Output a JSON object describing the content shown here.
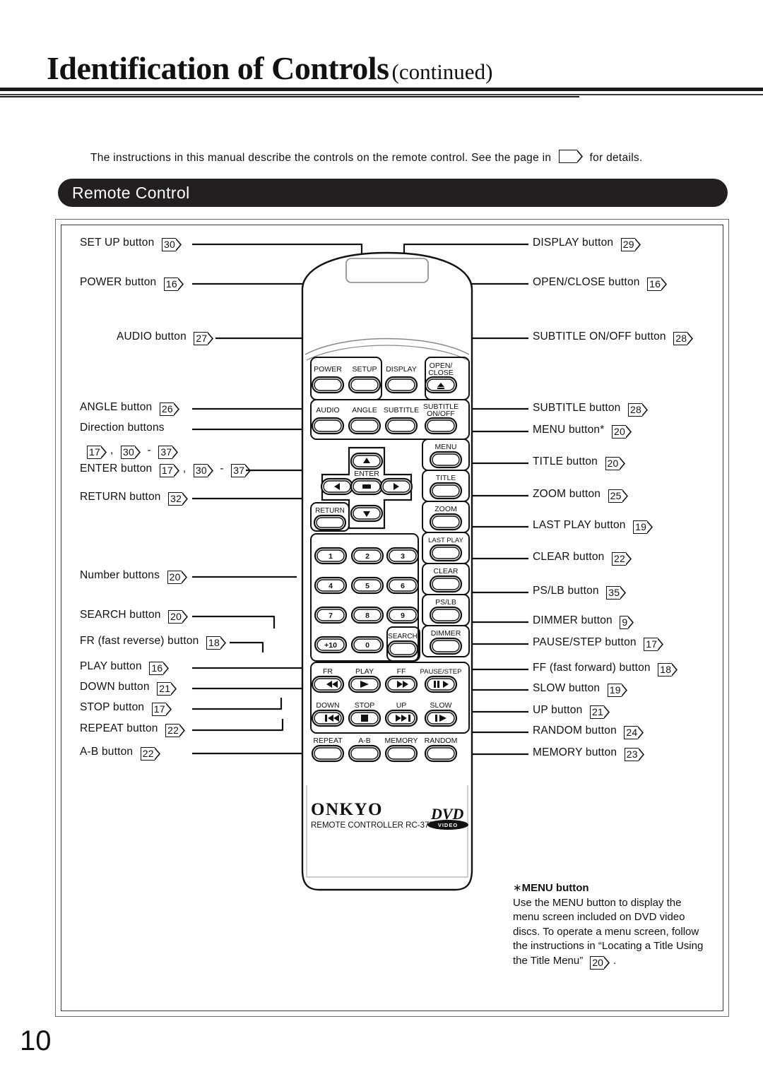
{
  "header": {
    "title_main": "Identification of Controls",
    "title_cont": "(continued)"
  },
  "intro": {
    "before": "The instructions in this manual describe the controls on the remote control. See the page in",
    "after": "for details."
  },
  "section": {
    "banner_label": "Remote Control"
  },
  "page_number": "10",
  "labels_left": [
    {
      "name": "setup",
      "text": "SET UP button",
      "ref": "30"
    },
    {
      "name": "power",
      "text": "POWER button",
      "ref": "16"
    },
    {
      "name": "audio",
      "text": "AUDIO button",
      "ref": "27"
    },
    {
      "name": "angle",
      "text": "ANGLE button",
      "ref": "26"
    },
    {
      "name": "direction",
      "text": "Direction buttons",
      "ref": ""
    },
    {
      "name": "enter",
      "text": "ENTER button",
      "ref": ""
    },
    {
      "name": "return",
      "text": "RETURN button",
      "ref": "32"
    },
    {
      "name": "number",
      "text": "Number buttons",
      "ref": "20"
    },
    {
      "name": "search",
      "text": "SEARCH button",
      "ref": "20"
    },
    {
      "name": "fr",
      "text": "FR (fast reverse) button",
      "ref": "18"
    },
    {
      "name": "play",
      "text": "PLAY button",
      "ref": "16"
    },
    {
      "name": "down",
      "text": "DOWN button",
      "ref": "21"
    },
    {
      "name": "stop",
      "text": "STOP button",
      "ref": "17"
    },
    {
      "name": "repeat",
      "text": "REPEAT button",
      "ref": "22"
    },
    {
      "name": "ab",
      "text": "A-B  button",
      "ref": "22"
    }
  ],
  "direction_refs": {
    "a": "17",
    "b": "30",
    "dash": "-",
    "c": "37",
    "comma": ","
  },
  "labels_right": [
    {
      "name": "display",
      "text": "DISPLAY button",
      "ref": "29"
    },
    {
      "name": "open-close",
      "text": "OPEN/CLOSE button",
      "ref": "16"
    },
    {
      "name": "subtitle-onoff",
      "text": "SUBTITLE ON/OFF button",
      "ref": "28"
    },
    {
      "name": "subtitle",
      "text": "SUBTITLE button",
      "ref": "28"
    },
    {
      "name": "menu",
      "text": "MENU button*",
      "ref": "20"
    },
    {
      "name": "title",
      "text": "TITLE button",
      "ref": "20"
    },
    {
      "name": "zoom",
      "text": "ZOOM button",
      "ref": "25"
    },
    {
      "name": "last-play",
      "text": "LAST PLAY button",
      "ref": "19"
    },
    {
      "name": "clear",
      "text": "CLEAR button",
      "ref": "22"
    },
    {
      "name": "pslb",
      "text": "PS/LB button",
      "ref": "35"
    },
    {
      "name": "dimmer",
      "text": "DIMMER button",
      "ref": "9"
    },
    {
      "name": "pause-step",
      "text": "PAUSE/STEP button",
      "ref": "17"
    },
    {
      "name": "ff",
      "text": "FF (fast forward) button",
      "ref": "18"
    },
    {
      "name": "slow",
      "text": "SLOW button",
      "ref": "19"
    },
    {
      "name": "up",
      "text": "UP button",
      "ref": "21"
    },
    {
      "name": "random",
      "text": "RANDOM button",
      "ref": "24"
    },
    {
      "name": "memory",
      "text": "MEMORY button",
      "ref": "23"
    }
  ],
  "remote": {
    "brand": "ONKYO",
    "model_line": "REMOTE CONTROLLER  RC-375DV",
    "disc_logo_main": "DVD",
    "disc_logo_sub": "VIDEO",
    "row1": [
      "POWER",
      "SETUP",
      "DISPLAY",
      "OPEN/\nCLOSE"
    ],
    "row2": [
      "AUDIO",
      "ANGLE",
      "SUBTITLE",
      "SUBTITLE\nON/OFF"
    ],
    "enter_label": "ENTER",
    "return_label": "RETURN",
    "side_col": [
      "MENU",
      "TITLE",
      "ZOOM",
      "LAST PLAY",
      "CLEAR",
      "PS/LB",
      "DIMMER"
    ],
    "numbers": [
      "1",
      "2",
      "3",
      "4",
      "5",
      "6",
      "7",
      "8",
      "9",
      "+10",
      "0"
    ],
    "search_label": "SEARCH",
    "transport1": [
      "FR",
      "PLAY",
      "FF",
      "PAUSE/STEP"
    ],
    "transport2": [
      "DOWN",
      "STOP",
      "UP",
      "SLOW"
    ],
    "transport3": [
      "REPEAT",
      "A-B",
      "MEMORY",
      "RANDOM"
    ]
  },
  "footnote": {
    "star": "∗",
    "heading": "MENU button",
    "body": "Use the MENU button to display the menu screen included on DVD video discs. To operate a menu screen, follow the instructions in “Locating a Title Using the Title Menu”",
    "ref": "20",
    "period": "."
  }
}
